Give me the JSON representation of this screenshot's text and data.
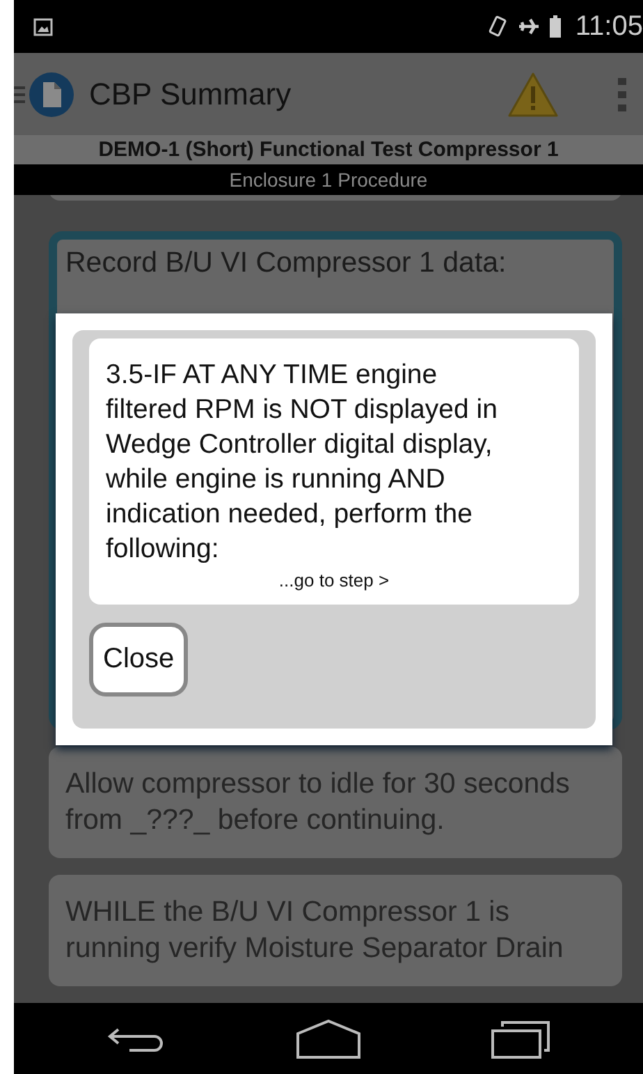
{
  "status_bar": {
    "time": "11:05"
  },
  "app_bar": {
    "title": "CBP Summary"
  },
  "header": {
    "title": "DEMO-1 (Short) Functional Test Compressor 1",
    "subtitle": "Enclosure 1 Procedure"
  },
  "steps": [
    {
      "kind": "partial"
    },
    {
      "kind": "active",
      "text": "Record B/U VI Compressor 1 data:"
    },
    {
      "kind": "normal",
      "text": "Allow compressor to idle for 30 seconds from _???_ before continuing."
    },
    {
      "kind": "normal",
      "text": "WHILE the B/U VI Compressor 1 is running verify Moisture Separator Drain"
    }
  ],
  "dialog": {
    "text": "3.5-IF AT ANY TIME engine filtered RPM is NOT displayed in Wedge Controller digital display, while engine is running AND indication needed, perform the following:",
    "link": "...go to step >",
    "button": "Close"
  }
}
